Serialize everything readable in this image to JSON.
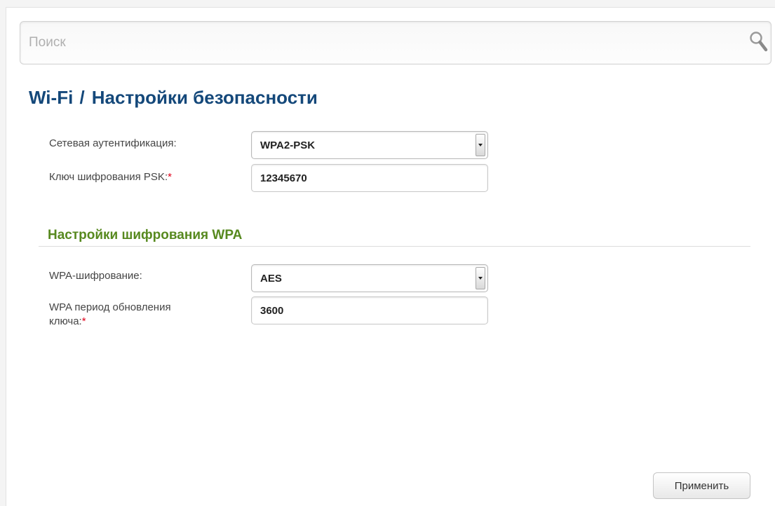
{
  "search": {
    "placeholder": "Поиск",
    "value": ""
  },
  "breadcrumb": {
    "section": "Wi-Fi",
    "separator": "/",
    "page": "Настройки безопасности"
  },
  "fields": {
    "auth": {
      "label": "Сетевая аутентификация:",
      "value": "WPA2-PSK"
    },
    "psk": {
      "label": "Ключ шифрования PSK:",
      "required_mark": "*",
      "value": "12345670"
    }
  },
  "wpa_section": {
    "title": "Настройки шифрования WPA",
    "encryption": {
      "label": "WPA-шифрование:",
      "value": "AES"
    },
    "rekey": {
      "label_line1": "WPA период обновления",
      "label_line2": "ключа:",
      "required_mark": "*",
      "value": "3600"
    }
  },
  "actions": {
    "apply_label": "Применить"
  },
  "icons": {
    "search": "search-icon",
    "dropdown": "chevron-down-icon"
  },
  "colors": {
    "title": "#14487a",
    "section_title": "#57891f",
    "required": "#e0001a"
  }
}
